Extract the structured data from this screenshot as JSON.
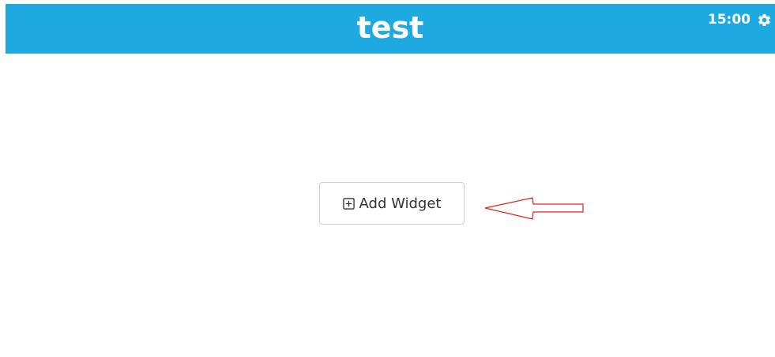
{
  "header": {
    "title": "test",
    "time": "15:00",
    "settings_icon": "gear-icon",
    "background_color": "#1eaae1"
  },
  "main": {
    "add_widget_label": "Add Widget",
    "add_widget_icon": "plus-square-icon"
  },
  "annotation": {
    "arrow_icon": "arrow-left-icon",
    "arrow_color": "#e02020"
  }
}
